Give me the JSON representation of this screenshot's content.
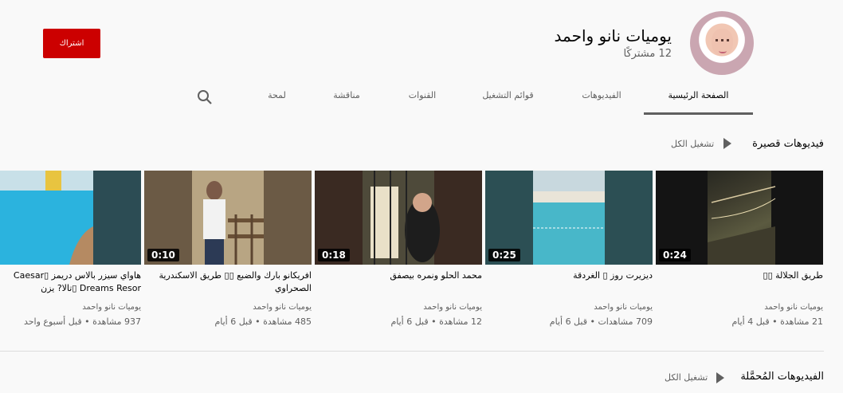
{
  "channel": {
    "title": "يوميات نانو واحمد",
    "subscribers": "12 مشتركًا",
    "subscribe_label": "اشتراك"
  },
  "tabs": [
    {
      "label": "الصفحة الرئيسية",
      "active": true
    },
    {
      "label": "الفيديوهات",
      "active": false
    },
    {
      "label": "قوائم التشغيل",
      "active": false
    },
    {
      "label": "القنوات",
      "active": false
    },
    {
      "label": "مناقشة",
      "active": false
    },
    {
      "label": "لمحة",
      "active": false
    }
  ],
  "shorts_section": {
    "title": "فيديوهات قصيرة",
    "play_all": "تشغيل الكل"
  },
  "videos": [
    {
      "title": "طريق الجلالة ▯▯",
      "channel": "يوميات نانو واحمد",
      "meta": "21 مشاهدة • قبل 4 أيام",
      "duration": "0:24"
    },
    {
      "title": "ديزيرت روز ▯ الغردقة",
      "channel": "يوميات نانو واحمد",
      "meta": "709 مشاهدات • قبل 6 أيام",
      "duration": "0:25"
    },
    {
      "title": "محمد الحلو ونمره بيصفق",
      "channel": "يوميات نانو واحمد",
      "meta": "12 مشاهدة • قبل 6 أيام",
      "duration": "0:18"
    },
    {
      "title": "افريكانو بارك والضبع ▯▯ طريق الاسكندرية الصحراوي",
      "channel": "يوميات نانو واحمد",
      "meta": "485 مشاهدة • قبل 6 أيام",
      "duration": "0:10"
    },
    {
      "title": "هاواي سيزر بالاس دريمز ▯Caesar Dreams Resor ▯تالا? يزن",
      "channel": "يوميات نانو واحمد",
      "meta": "937 مشاهدة • قبل أسبوع واحد",
      "duration": ""
    }
  ],
  "uploads_section": {
    "title": "الفيديوهات المُحمَّلة",
    "play_all": "تشغيل الكل"
  },
  "icons": {
    "search": "search-icon",
    "play": "play-icon"
  },
  "colors": {
    "subscribe": "#cc0000",
    "background": "#f9f9f9",
    "secondary_text": "#606060"
  }
}
